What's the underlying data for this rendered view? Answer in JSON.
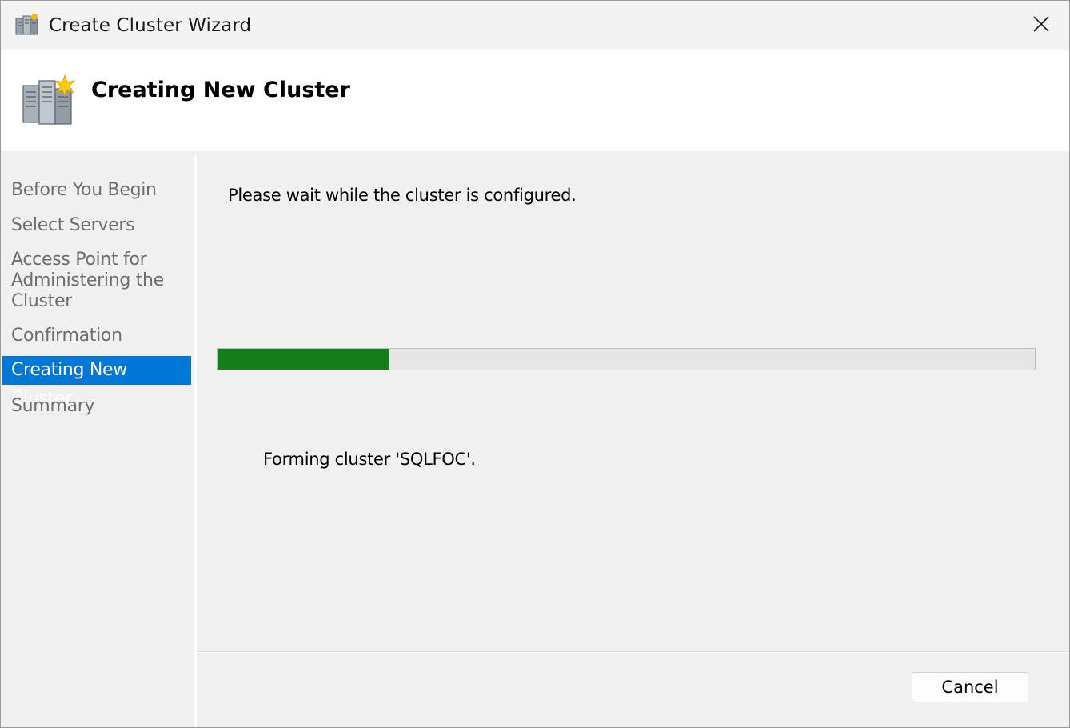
{
  "window": {
    "title": "Create Cluster Wizard",
    "icon": "cluster-icon",
    "close_icon": "close-icon"
  },
  "header": {
    "title": "Creating New Cluster",
    "icon": "cluster-wizard-icon"
  },
  "steps": [
    {
      "label": "Before You Begin",
      "active": false
    },
    {
      "label": "Select Servers",
      "active": false
    },
    {
      "label": "Access Point for Administering the Cluster",
      "active": false
    },
    {
      "label": "Confirmation",
      "active": false
    },
    {
      "label": "Creating New Cluster",
      "active": true
    },
    {
      "label": "Summary",
      "active": false
    }
  ],
  "main": {
    "message": "Please wait while the cluster is configured.",
    "progress_fraction": 0.21,
    "status": "Forming cluster 'SQLFOC'."
  },
  "footer": {
    "cancel_label": "Cancel"
  },
  "colors": {
    "accent": "#0078d7",
    "progress": "#137e1a"
  }
}
